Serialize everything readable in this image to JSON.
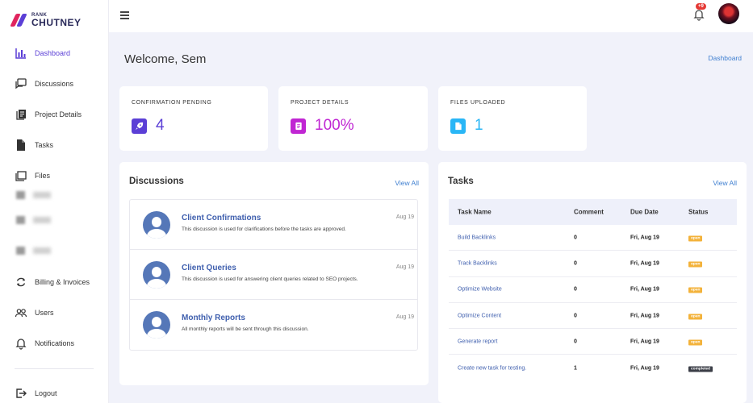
{
  "brand": {
    "small": "RANK",
    "big": "CHUTNEY"
  },
  "sidebar": {
    "items": [
      {
        "label": "Dashboard",
        "icon": "bar-chart-icon",
        "active": true
      },
      {
        "label": "Discussions",
        "icon": "chat-icon"
      },
      {
        "label": "Project Details",
        "icon": "document-stack-icon"
      },
      {
        "label": "Tasks",
        "icon": "file-icon"
      },
      {
        "label": "Files",
        "icon": "folder-icon"
      },
      {
        "label": "Billing & Invoices",
        "icon": "refresh-icon"
      },
      {
        "label": "Users",
        "icon": "users-icon"
      },
      {
        "label": "Notifications",
        "icon": "bell-icon"
      }
    ],
    "logout": "Logout"
  },
  "topbar": {
    "notification_count": "+9"
  },
  "page": {
    "welcome": "Welcome, Sem",
    "breadcrumb": "Dashboard"
  },
  "stats": [
    {
      "title": "CONFIRMATION PENDING",
      "value": "4",
      "color": "#5b3fd6",
      "icon": "rocket-icon"
    },
    {
      "title": "PROJECT DETAILS",
      "value": "100%",
      "color": "#c026d3",
      "icon": "document-icon"
    },
    {
      "title": "FILES UPLOADED",
      "value": "1",
      "color": "#29b6f6",
      "icon": "file-icon"
    }
  ],
  "discussions": {
    "title": "Discussions",
    "view_all": "View All",
    "items": [
      {
        "title": "Client Confirmations",
        "desc": "This discussion is used for clarifications before the tasks are approved.",
        "date": "Aug 19"
      },
      {
        "title": "Client Queries",
        "desc": "This discussion is used for answering client queries related to SEO projects.",
        "date": "Aug 19"
      },
      {
        "title": "Monthly Reports",
        "desc": "All monthly reports will be sent through this discussion.",
        "date": "Aug 19"
      }
    ]
  },
  "tasks": {
    "title": "Tasks",
    "view_all": "View All",
    "columns": [
      "Task Name",
      "Comment",
      "Due Date",
      "Status"
    ],
    "rows": [
      {
        "name": "Build Backlinks",
        "comment": "0",
        "due": "Fri, Aug 19",
        "status": "open"
      },
      {
        "name": "Track Backlinks",
        "comment": "0",
        "due": "Fri, Aug 19",
        "status": "open"
      },
      {
        "name": "Optimize Website",
        "comment": "0",
        "due": "Fri, Aug 19",
        "status": "open"
      },
      {
        "name": "Optimize Content",
        "comment": "0",
        "due": "Fri, Aug 19",
        "status": "open"
      },
      {
        "name": "Generate report",
        "comment": "0",
        "due": "Fri, Aug 19",
        "status": "open"
      },
      {
        "name": "Create new task for testing.",
        "comment": "1",
        "due": "Fri, Aug 19",
        "status": "completed"
      }
    ]
  }
}
